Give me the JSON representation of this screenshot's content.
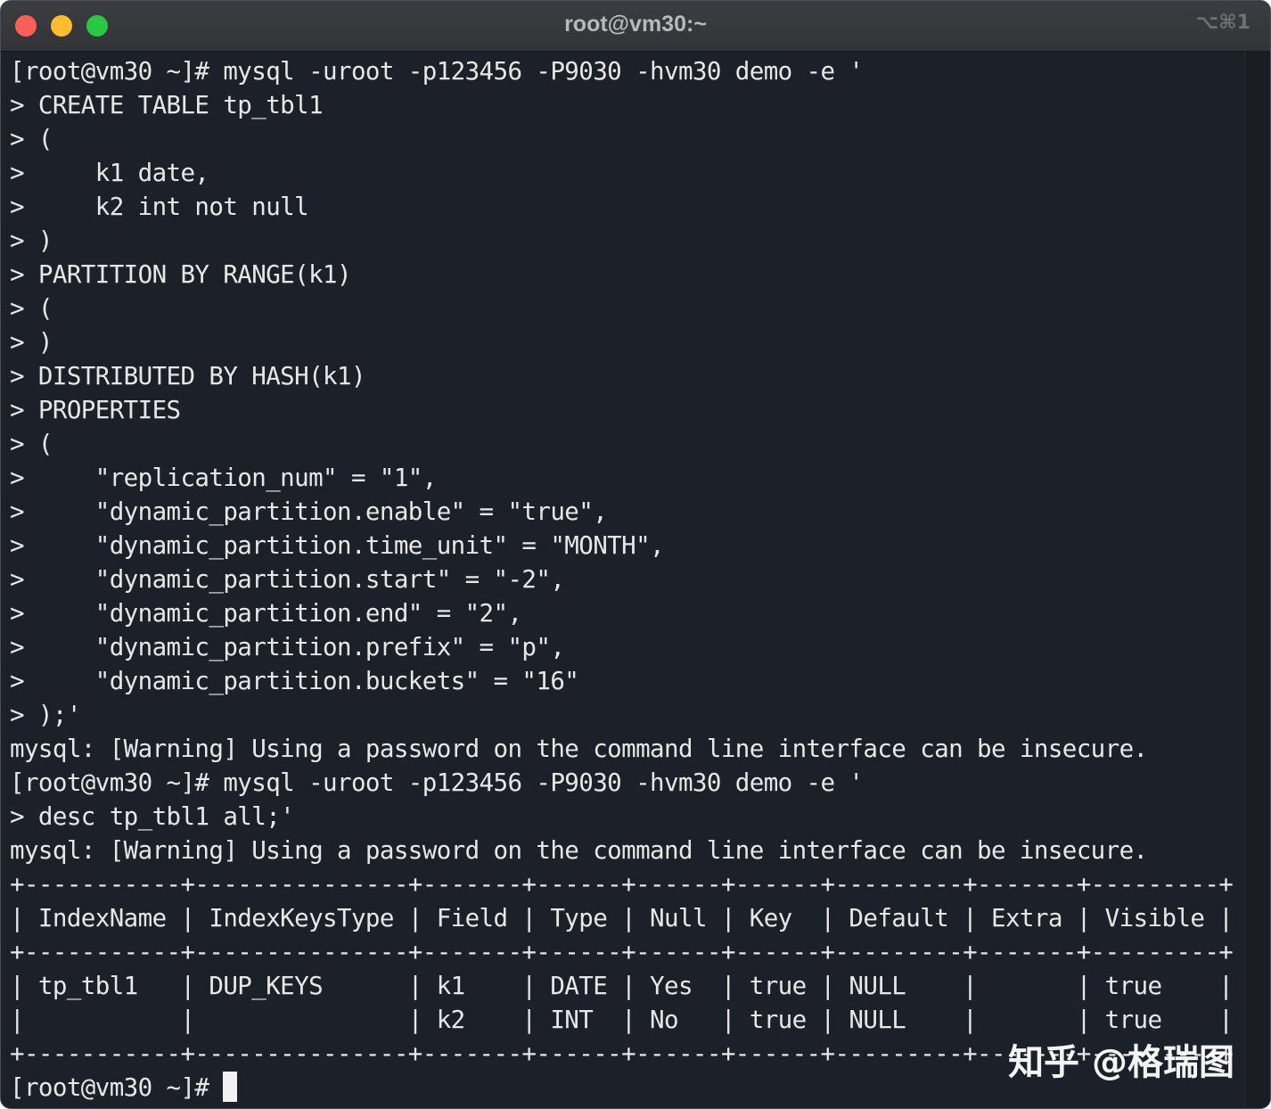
{
  "window": {
    "title": "root@vm30:~",
    "shortcut": "⌥⌘1"
  },
  "terminal": {
    "lines": [
      "[root@vm30 ~]# mysql -uroot -p123456 -P9030 -hvm30 demo -e '",
      "> CREATE TABLE tp_tbl1",
      "> (",
      ">     k1 date,",
      ">     k2 int not null",
      "> )",
      "> PARTITION BY RANGE(k1)",
      "> (",
      "> )",
      "> DISTRIBUTED BY HASH(k1)",
      "> PROPERTIES",
      "> (",
      ">     \"replication_num\" = \"1\",",
      ">     \"dynamic_partition.enable\" = \"true\",",
      ">     \"dynamic_partition.time_unit\" = \"MONTH\",",
      ">     \"dynamic_partition.start\" = \"-2\",",
      ">     \"dynamic_partition.end\" = \"2\",",
      ">     \"dynamic_partition.prefix\" = \"p\",",
      ">     \"dynamic_partition.buckets\" = \"16\"",
      "> );'",
      "mysql: [Warning] Using a password on the command line interface can be insecure.",
      "[root@vm30 ~]# mysql -uroot -p123456 -P9030 -hvm30 demo -e '",
      "> desc tp_tbl1 all;'",
      "mysql: [Warning] Using a password on the command line interface can be insecure.",
      "+-----------+---------------+-------+------+------+------+---------+-------+---------+",
      "| IndexName | IndexKeysType | Field | Type | Null | Key  | Default | Extra | Visible |",
      "+-----------+---------------+-------+------+------+------+---------+-------+---------+",
      "| tp_tbl1   | DUP_KEYS      | k1    | DATE | Yes  | true | NULL    |       | true    |",
      "|           |               | k2    | INT  | No   | true | NULL    |       | true    |",
      "+-----------+---------------+-------+------+------+------+---------+-------+---------+"
    ],
    "prompt": "[root@vm30 ~]# "
  },
  "watermark": "知乎 @格瑞图"
}
